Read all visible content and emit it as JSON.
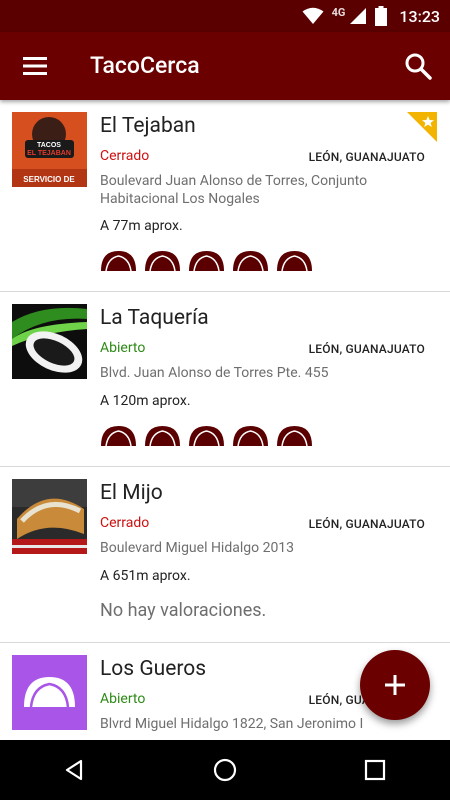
{
  "status_bar": {
    "time": "13:23",
    "network_label": "4G",
    "icons": [
      "wifi-icon",
      "cell-signal-icon",
      "battery-icon"
    ]
  },
  "app_bar": {
    "title": "TacoCerca",
    "menu_icon": "menu-icon",
    "search_icon": "search-icon"
  },
  "places": [
    {
      "name": "El Tejaban",
      "status": "Cerrado",
      "status_type": "closed",
      "city": "LEÓN, GUANAJUATO",
      "address": "Boulevard Juan Alonso de Torres, Conjunto Habitacional Los Nogales",
      "distance": "A 77m aprox.",
      "rating": 5,
      "favorite": true,
      "thumb_lines": [
        "TACOS",
        "EL TEJABAN",
        "SERVICIO DE"
      ]
    },
    {
      "name": "La Taquería",
      "status": "Abierto",
      "status_type": "open",
      "city": "LEÓN, GUANAJUATO",
      "address": "Blvd. Juan Alonso de Torres Pte. 455",
      "distance": "A 120m aprox.",
      "rating": 5,
      "favorite": false
    },
    {
      "name": "El Mijo",
      "status": "Cerrado",
      "status_type": "closed",
      "city": "LEÓN, GUANAJUATO",
      "address": "Boulevard Miguel Hidalgo 2013",
      "distance": "A 651m aprox.",
      "rating": 0,
      "no_ratings_text": "No hay valoraciones.",
      "favorite": false
    },
    {
      "name": "Los Gueros",
      "status": "Abierto",
      "status_type": "open",
      "city": "LEÓN, GUANAJUATO",
      "address": "Blvrd Miguel Hidalgo 1822, San Jeronimo I",
      "favorite": false
    }
  ],
  "fab": {
    "icon": "add-icon"
  },
  "nav_bar": {
    "icons": [
      "back-icon",
      "home-icon",
      "recents-icon"
    ]
  },
  "colors": {
    "primary": "#6a0000",
    "primary_dark": "#5a0000",
    "closed": "#cc1111",
    "open": "#2e8a16",
    "taco_placeholder": "#a855e8"
  }
}
